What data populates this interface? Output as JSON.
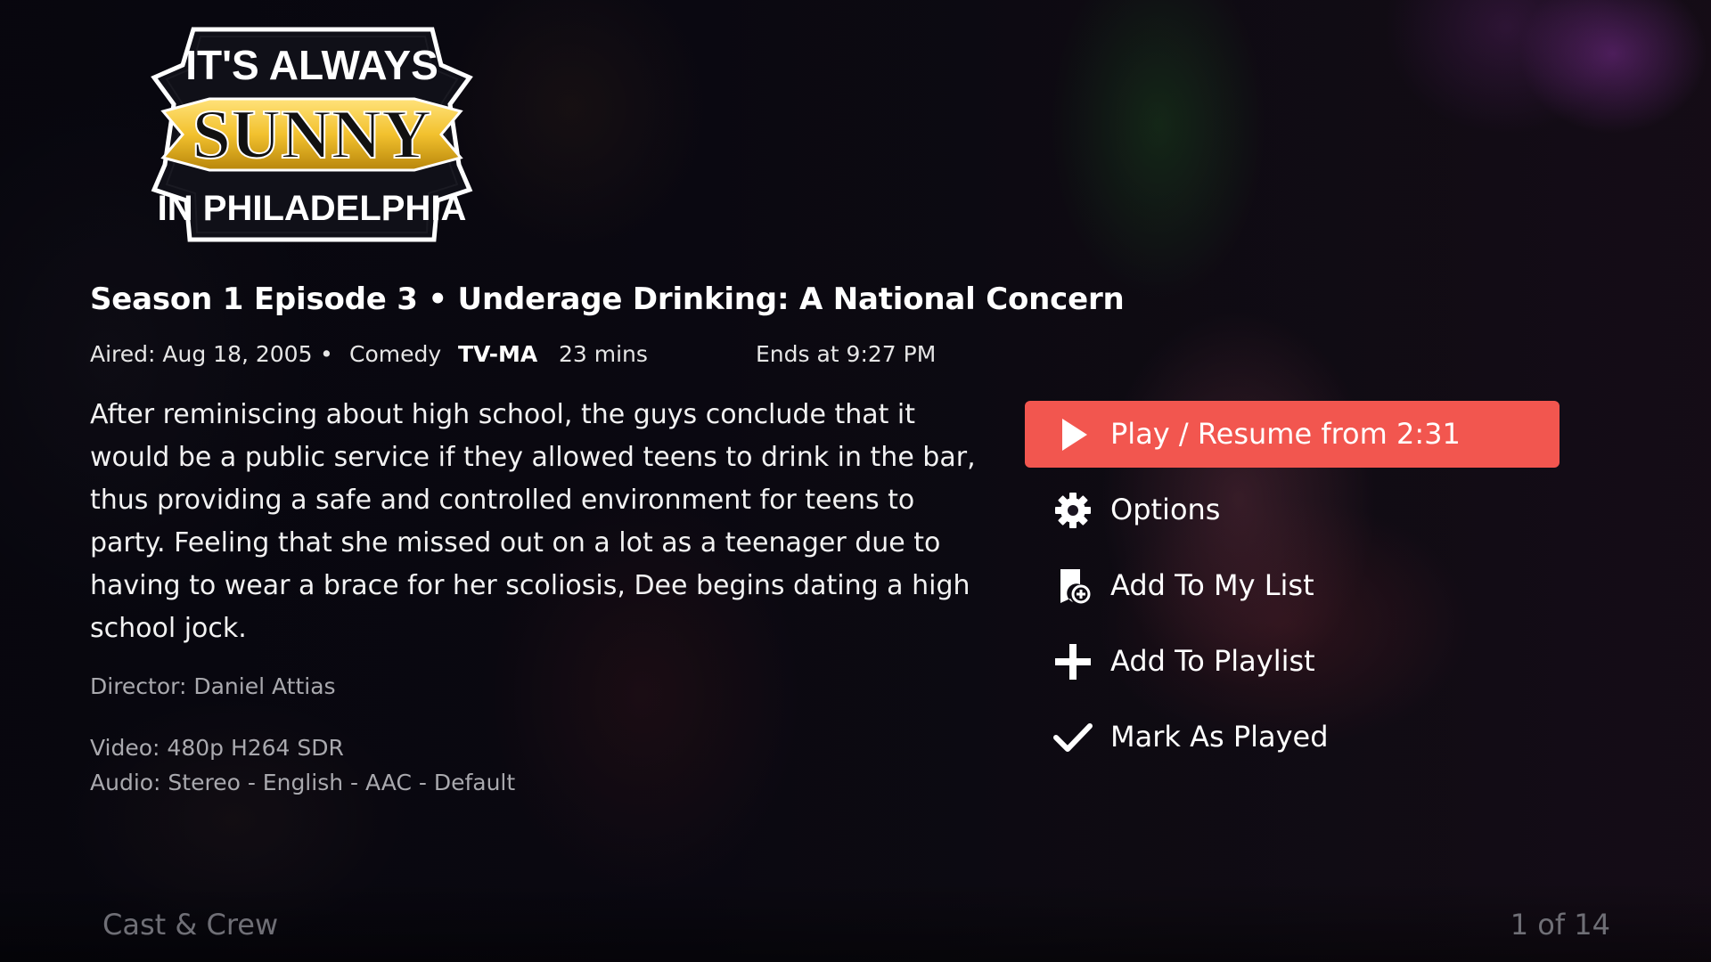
{
  "show": {
    "logo_line1": "IT'S ALWAYS",
    "logo_line2": "SUNNY",
    "logo_line3": "IN PHILADELPHIA"
  },
  "episode": {
    "title": "Season 1 Episode 3 • Underage Drinking: A National Concern",
    "aired": "Aired: Aug 18, 2005",
    "separator": "•",
    "genre": "Comedy",
    "rating": "TV-MA",
    "duration": "23 mins",
    "ends_at": "Ends at 9:27 PM",
    "summary": "After reminiscing about high school, the guys conclude that it would be a public service if they allowed teens to drink in the bar, thus providing a safe and controlled environment for teens to party. Feeling that she missed out on a lot as a teenager due to having to wear a brace for her scoliosis, Dee begins dating a high school jock.",
    "director": "Director: Daniel Attias",
    "video": "Video: 480p H264 SDR",
    "audio": "Audio: Stereo - English - AAC - Default"
  },
  "actions": [
    {
      "label": "Play / Resume from 2:31",
      "icon": "play-icon",
      "focused": true
    },
    {
      "label": "Options",
      "icon": "gear-icon",
      "focused": false
    },
    {
      "label": "Add To My List",
      "icon": "bookmark-add-icon",
      "focused": false
    },
    {
      "label": "Add To Playlist",
      "icon": "plus-icon",
      "focused": false
    },
    {
      "label": "Mark As Played",
      "icon": "checkmark-icon",
      "focused": false
    }
  ],
  "footer": {
    "cast_crew": "Cast & Crew",
    "pager": "1 of 14"
  },
  "colors": {
    "accent": "#f2564f",
    "muted_text": "#a9a9ae",
    "footer_text": "#6f6f76",
    "logo_gold": "#f2c12e"
  }
}
